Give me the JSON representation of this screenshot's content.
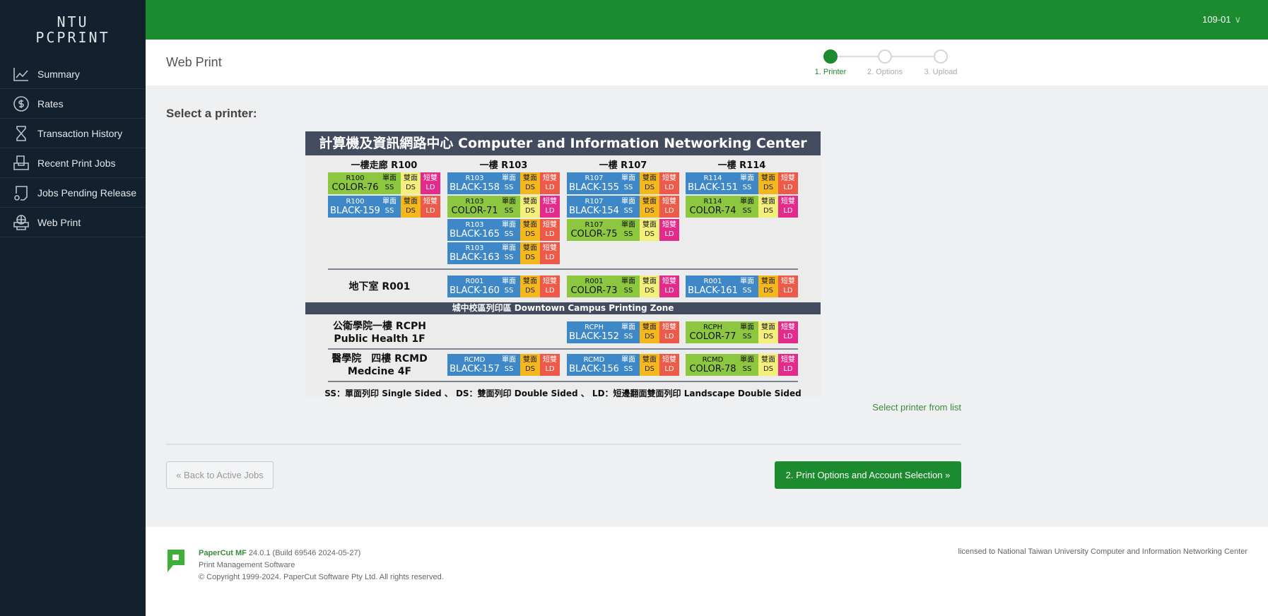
{
  "brand": {
    "line1": "NTU",
    "line2": "PCPRINT"
  },
  "sidebar": {
    "items": [
      {
        "label": "Summary",
        "icon": "chart-line-icon"
      },
      {
        "label": "Rates",
        "icon": "dollar-circle-icon"
      },
      {
        "label": "Transaction History",
        "icon": "hourglass-icon"
      },
      {
        "label": "Recent Print Jobs",
        "icon": "printer-tray-icon"
      },
      {
        "label": "Jobs Pending Release",
        "icon": "document-pending-icon"
      },
      {
        "label": "Web Print",
        "icon": "web-printer-icon"
      }
    ]
  },
  "topbar": {
    "user": "109-01",
    "user_icon": "chevron-down-icon"
  },
  "header": {
    "title": "Web Print",
    "steps": [
      {
        "label": "1. Printer",
        "active": true
      },
      {
        "label": "2. Options",
        "active": false
      },
      {
        "label": "3. Upload",
        "active": false
      }
    ]
  },
  "main": {
    "heading": "Select a printer:",
    "list_link": "Select printer from list",
    "back_button": "« Back to Active Jobs",
    "next_button": "2. Print Options and Account Selection »"
  },
  "map": {
    "title": "計算機及資訊網路中心 Computer and Information Networking Center",
    "tile_labels": {
      "ss_zh": "單面",
      "ss": "SS",
      "ds_zh": "雙面",
      "ds": "DS",
      "ld_zh": "短雙",
      "ld": "LD"
    },
    "columns": [
      "一樓走廊 R100",
      "一樓 R103",
      "一樓 R107",
      "一樓 R114"
    ],
    "first_floor": [
      [
        {
          "room": "R100",
          "name": "COLOR-76",
          "type": "color"
        },
        {
          "room": "R100",
          "name": "BLACK-159",
          "type": "black"
        }
      ],
      [
        {
          "room": "R103",
          "name": "BLACK-158",
          "type": "black"
        },
        {
          "room": "R103",
          "name": "COLOR-71",
          "type": "color"
        },
        {
          "room": "R103",
          "name": "BLACK-165",
          "type": "black"
        },
        {
          "room": "R103",
          "name": "BLACK-163",
          "type": "black"
        }
      ],
      [
        {
          "room": "R107",
          "name": "BLACK-155",
          "type": "black"
        },
        {
          "room": "R107",
          "name": "BLACK-154",
          "type": "black"
        },
        {
          "room": "R107",
          "name": "COLOR-75",
          "type": "color"
        }
      ],
      [
        {
          "room": "R114",
          "name": "BLACK-151",
          "type": "black"
        },
        {
          "room": "R114",
          "name": "COLOR-74",
          "type": "color"
        }
      ]
    ],
    "basement": {
      "label": "地下室 R001",
      "printers": [
        null,
        {
          "room": "R001",
          "name": "BLACK-160",
          "type": "black"
        },
        {
          "room": "R001",
          "name": "COLOR-73",
          "type": "color"
        },
        {
          "room": "R001",
          "name": "BLACK-161",
          "type": "black"
        }
      ]
    },
    "downtown_title": "城中校區列印區 Downtown Campus Printing Zone",
    "rcph": {
      "label1": "公衛學院一樓 RCPH",
      "label2": "Public Health 1F",
      "printers": [
        null,
        null,
        {
          "room": "RCPH",
          "name": "BLACK-152",
          "type": "black"
        },
        {
          "room": "RCPH",
          "name": "COLOR-77",
          "type": "color"
        }
      ]
    },
    "rcmd": {
      "label1": "醫學院　四樓 RCMD",
      "label2": "Medcine 4F",
      "printers": [
        null,
        {
          "room": "RCMD",
          "name": "BLACK-157",
          "type": "black"
        },
        {
          "room": "RCMD",
          "name": "BLACK-156",
          "type": "black"
        },
        {
          "room": "RCMD",
          "name": "COLOR-78",
          "type": "color"
        }
      ]
    },
    "legend": "SS：單面列印 Single Sided 、 DS：雙面列印 Double Sided 、 LD：短邊翻面雙面列印 Landscape Double Sided"
  },
  "footer": {
    "product": "PaperCut MF",
    "version": "24.0.1 (Build 69546 2024-05-27)",
    "tagline": "Print Management Software",
    "copyright": "© Copyright 1999-2024. PaperCut Software Pty Ltd. All rights reserved.",
    "license": "licensed to National Taiwan University Computer and Information Networking Center"
  },
  "colors": {
    "brand_green": "#1c8a2e",
    "sidebar": "#13202e",
    "black_tile": "#3f88c8",
    "color_tile": "#8dc63f"
  }
}
